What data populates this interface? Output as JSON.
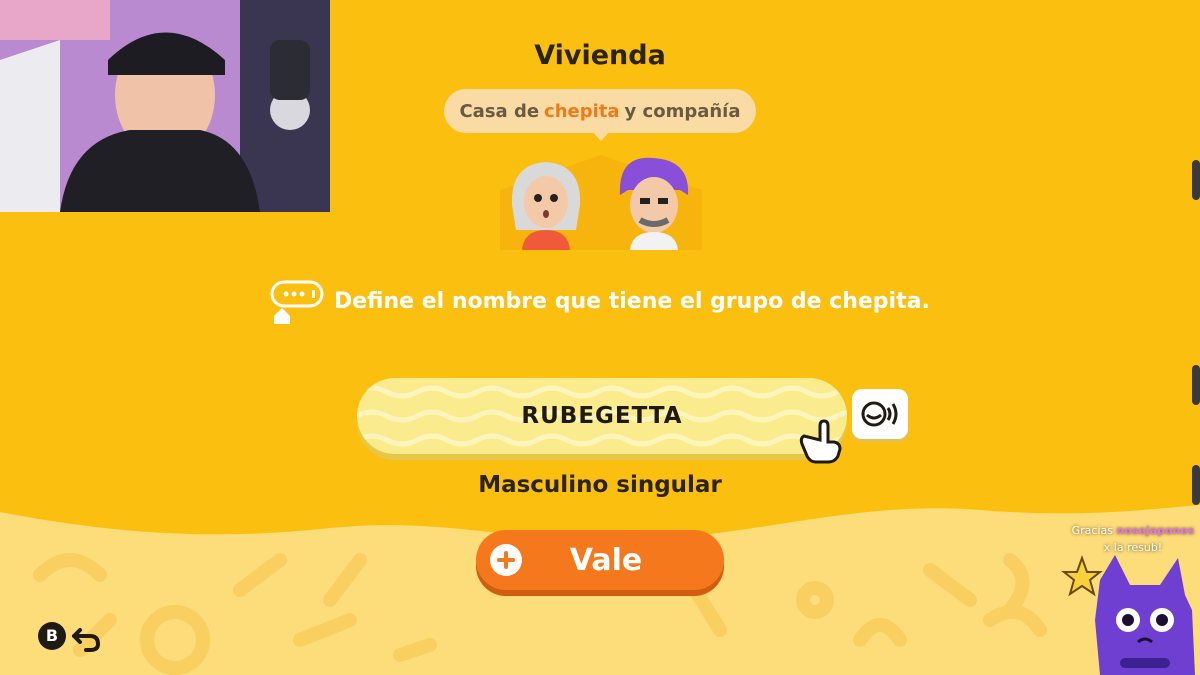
{
  "header": {
    "title": "Vivienda"
  },
  "residence": {
    "prefix": "Casa de",
    "owner": "chepita",
    "suffix": "y compañía"
  },
  "prompt": {
    "text": "Define el nombre que tiene el grupo de chepita."
  },
  "name_field": {
    "value": "RUBEGETTA"
  },
  "gender_selector": {
    "value": "Masculino singular"
  },
  "confirm_button": {
    "label": "Vale"
  },
  "back_button": {
    "key_label": "B"
  },
  "stream_alert": {
    "thanks": "Gracias",
    "username": "nosejapones",
    "message": "x la resub!"
  },
  "colors": {
    "background": "#fbbf10",
    "bottom_panel": "#fddc7a",
    "highlight_name": "#f07a1a",
    "confirm_button": "#f6781c",
    "text_dark": "#2b2412"
  },
  "icons": [
    "speech-bubble-house-icon",
    "voice-icon",
    "plus-icon",
    "b-button-icon",
    "back-arrow-icon",
    "pointer-hand-icon",
    "star-icon"
  ]
}
